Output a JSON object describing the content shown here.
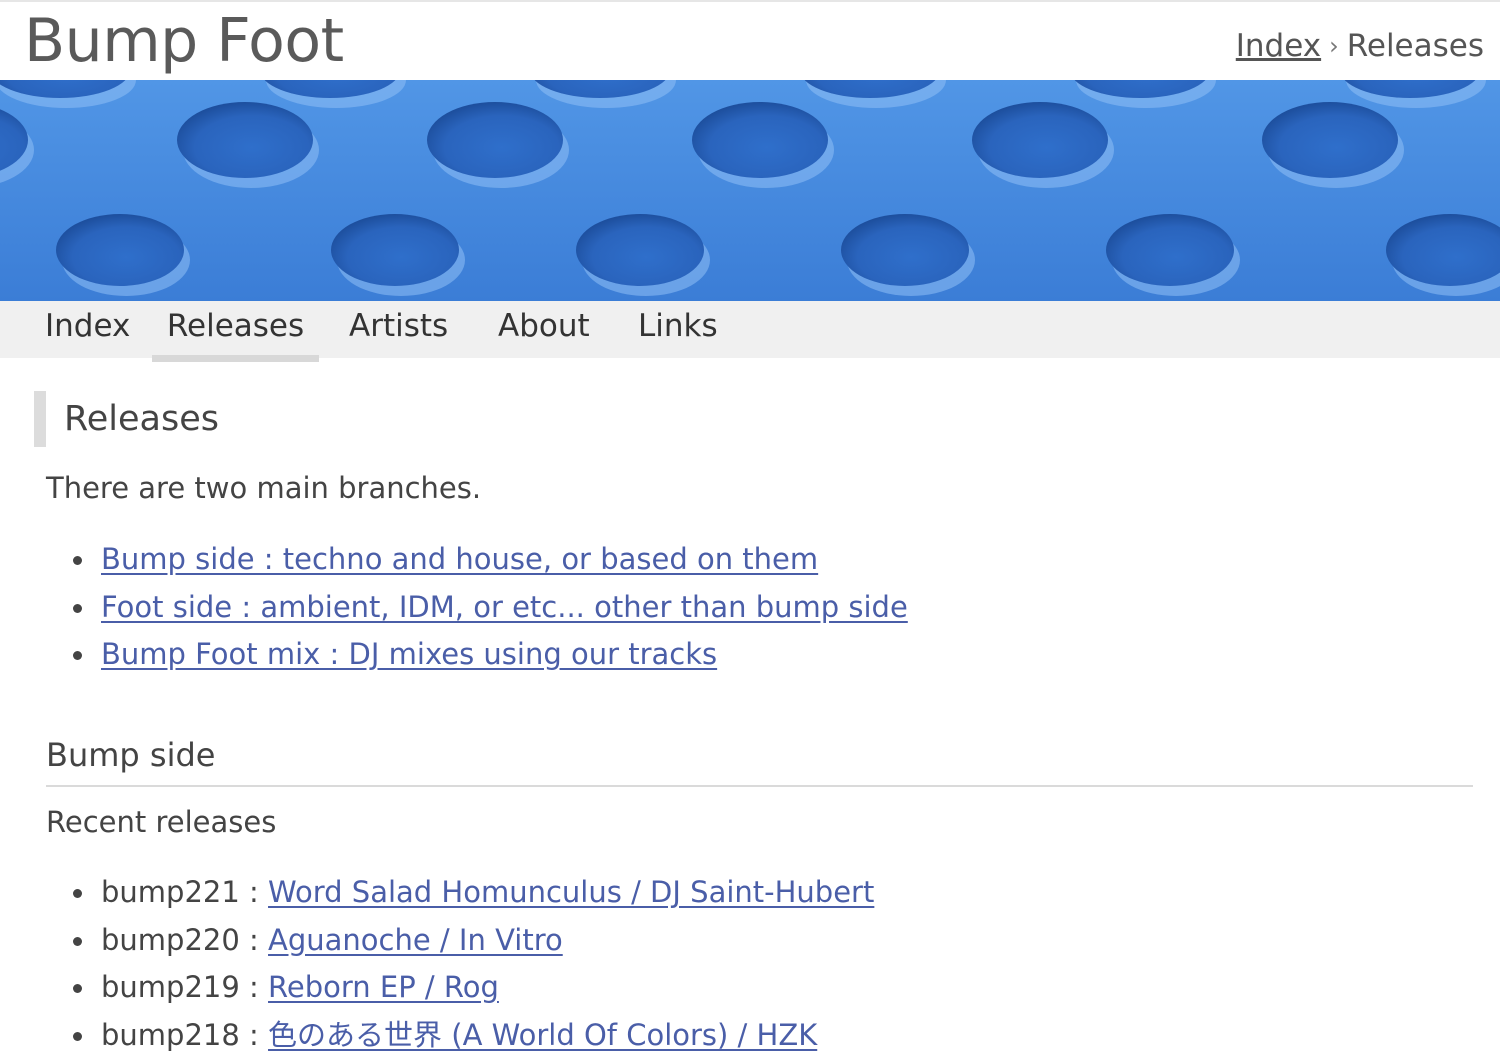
{
  "header": {
    "site_title": "Bump Foot",
    "breadcrumb": {
      "home": "Index",
      "current": "Releases"
    }
  },
  "nav": {
    "items": [
      {
        "label": "Index"
      },
      {
        "label": "Releases"
      },
      {
        "label": "Artists"
      },
      {
        "label": "About"
      },
      {
        "label": "Links"
      }
    ],
    "active": "Releases"
  },
  "main": {
    "heading": "Releases",
    "intro": "There are two main branches.",
    "branches": [
      {
        "label": "Bump side : techno and house, or based on them"
      },
      {
        "label": "Foot side : ambient, IDM, or etc... other than bump side"
      },
      {
        "label": "Bump Foot mix : DJ mixes using our tracks"
      }
    ],
    "bump_side": {
      "heading": "Bump side",
      "subheading": "Recent releases",
      "releases": [
        {
          "catalog": "bump221",
          "sep": " : ",
          "title": "Word Salad Homunculus / DJ Saint-Hubert"
        },
        {
          "catalog": "bump220",
          "sep": " : ",
          "title": "Aguanoche / In Vitro"
        },
        {
          "catalog": "bump219",
          "sep": " : ",
          "title": "Reborn EP / Rog"
        },
        {
          "catalog": "bump218",
          "sep": " : ",
          "title": "色のある世界 (A World Of Colors) / HZK"
        }
      ]
    }
  },
  "colors": {
    "link": "#4a5ea8",
    "banner_blue": "#3a7fd8",
    "nav_background": "#f0f0f0"
  }
}
